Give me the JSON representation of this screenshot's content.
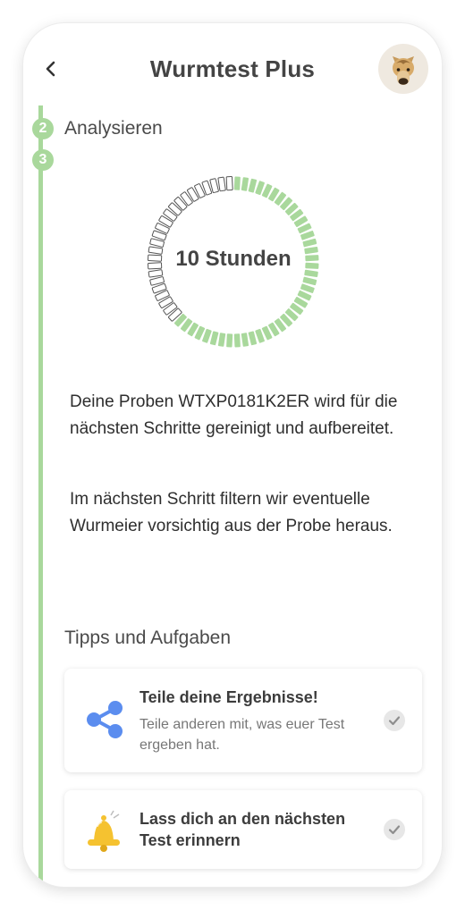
{
  "header": {
    "title": "Wurmtest Plus",
    "back_icon": "chevron-left-icon",
    "avatar_icon": "alpaca-avatar"
  },
  "steps": {
    "current_number": "2",
    "next_number": "3",
    "current_title": "Analysieren"
  },
  "timer": {
    "label": "10 Stunden",
    "progress_fraction": 0.62,
    "segments": 64,
    "active_color": "#a9d89c",
    "inactive_color": "#ffffff"
  },
  "description": {
    "paragraph1": "Deine Proben WTXP0181K2ER wird für die nächsten Schritte gereinigt und aufbereitet.",
    "paragraph2": "Im nächsten Schritt filtern wir eventuelle Wurmeier vorsichtig aus der Probe heraus."
  },
  "tips": {
    "section_title": "Tipps und Aufgaben",
    "cards": [
      {
        "icon": "share-icon",
        "title": "Teile deine Ergebnisse!",
        "subtitle": "Teile anderen mit, was euer Test ergeben hat.",
        "status_icon": "check-icon"
      },
      {
        "icon": "bell-icon",
        "title": "Lass dich an den nächsten Test erinnern",
        "subtitle": "",
        "status_icon": "check-icon"
      }
    ]
  },
  "colors": {
    "accent_green": "#a9d89c",
    "share_blue": "#5b8def",
    "bell_yellow": "#f5c230"
  }
}
